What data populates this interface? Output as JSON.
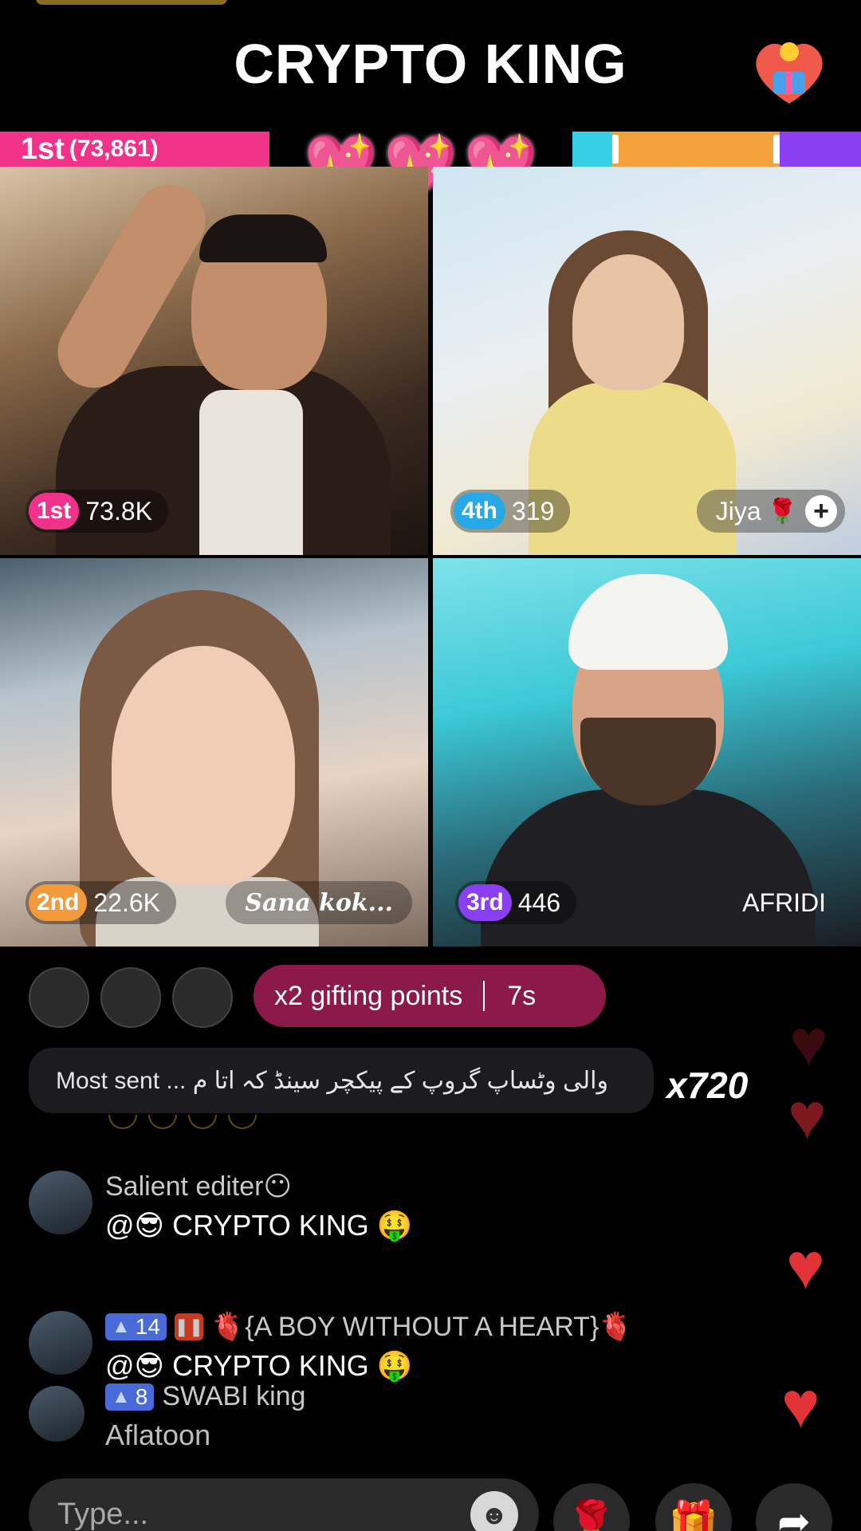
{
  "header": {
    "title": "CRYPTO KING",
    "hearts": [
      "💖",
      "💖",
      "💖"
    ]
  },
  "score_bar": {
    "leader_rank": "1st",
    "leader_points": "(73,861)"
  },
  "tiles": [
    {
      "rank": "1st",
      "score": "73.8K",
      "name": ""
    },
    {
      "rank": "4th",
      "score": "319",
      "name": "Jiya"
    },
    {
      "rank": "2nd",
      "score": "22.6K",
      "name": "Sana kok..."
    },
    {
      "rank": "3rd",
      "score": "446",
      "name": "AFRIDI"
    }
  ],
  "gifting": {
    "label": "x2 gifting points",
    "timer": "7s"
  },
  "most_sent": {
    "text": "Most sent ... والی وٹساپ گروپ کے پیکچر سینڈ کہ اتا م",
    "multiplier": "x720"
  },
  "chat": [
    {
      "name": "Salient editer😶",
      "message": "@😎 CRYPTO KING 🤑"
    },
    {
      "level": "14",
      "name": "🫀{A BOY WITHOUT A HEART}🫀",
      "message": "@😎 CRYPTO KING 🤑"
    },
    {
      "level": "8",
      "name": "SWABI king",
      "message": "Aflatoon"
    }
  ],
  "input": {
    "placeholder": "Type..."
  },
  "icons": {
    "emoji": "emoji-icon",
    "rose": "rose-icon",
    "gift": "gift-icon",
    "share": "share-icon",
    "plus": "plus-icon"
  }
}
